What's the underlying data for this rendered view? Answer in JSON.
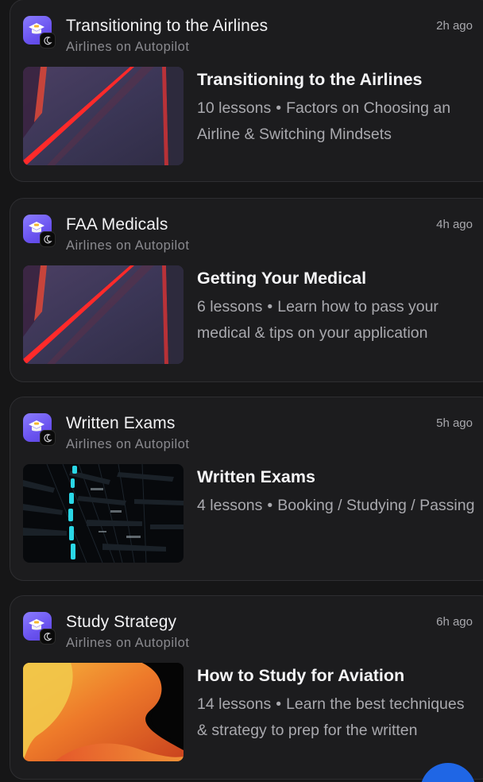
{
  "posts": [
    {
      "title": "Transitioning to the Airlines",
      "subtitle": "Airlines on Autopilot",
      "time": "2h ago",
      "course_title": "Transitioning to the Airlines",
      "lessons": "10 lessons",
      "separator": "•",
      "description": "Factors on Choosing an Airline & Switching Mindsets",
      "thumbnail": "red-glass-abstract"
    },
    {
      "title": "FAA Medicals",
      "subtitle": "Airlines on Autopilot",
      "time": "4h ago",
      "course_title": "Getting Your Medical",
      "lessons": "6 lessons",
      "separator": "•",
      "description": "Learn how to pass your medical & tips on your application",
      "thumbnail": "red-glass-abstract"
    },
    {
      "title": "Written Exams",
      "subtitle": "Airlines on Autopilot",
      "time": "5h ago",
      "course_title": "Written Exams",
      "lessons": "4 lessons",
      "separator": "•",
      "description": "Booking / Studying / Passing",
      "thumbnail": "dark-teal-tunnel"
    },
    {
      "title": "Study Strategy",
      "subtitle": "Airlines on Autopilot",
      "time": "6h ago",
      "course_title": "How to Study for Aviation",
      "lessons": "14 lessons",
      "separator": "•",
      "description": "Learn the best techniques & strategy to prep for the written",
      "thumbnail": "orange-waves"
    }
  ],
  "app_icon": "graduation-cap-icon",
  "colors": {
    "background": "#161617",
    "card": "#1c1c1e",
    "accent": "#6a53ef",
    "fab": "#1f66e5"
  }
}
